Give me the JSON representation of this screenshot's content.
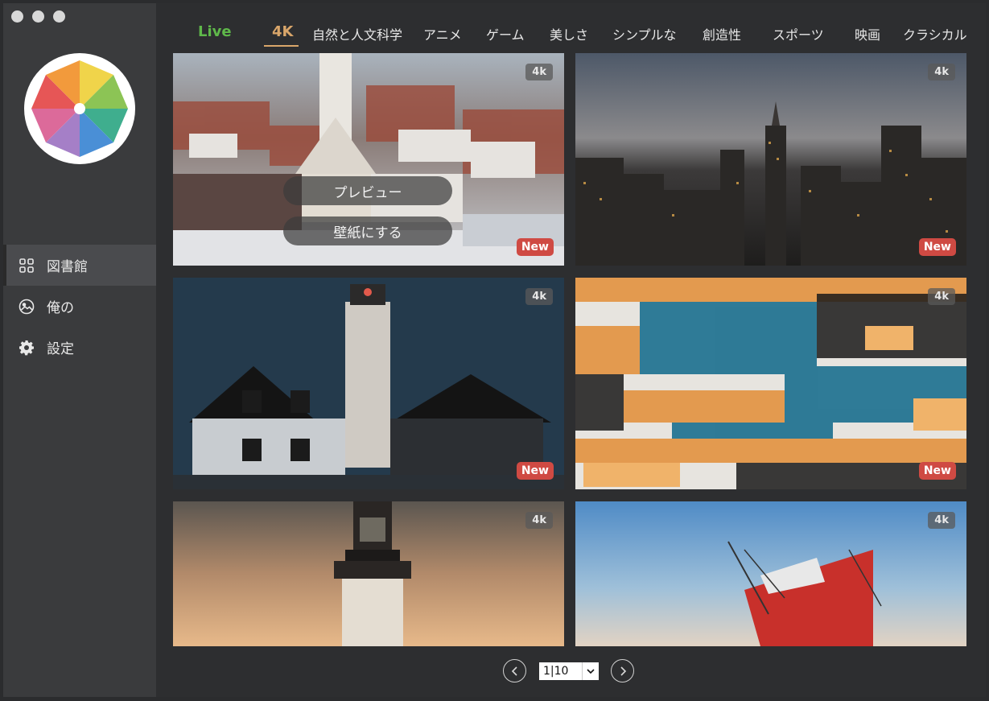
{
  "tabs": [
    "Live",
    "4K",
    "自然と人文科学",
    "アニメ",
    "ゲーム",
    "美しさ",
    "シンプルな",
    "創造性",
    "スポーツ",
    "映画",
    "クラシカル"
  ],
  "sidebar": {
    "items": [
      {
        "label": "図書館",
        "icon": "grid-icon"
      },
      {
        "label": "俺の",
        "icon": "image-icon"
      },
      {
        "label": "設定",
        "icon": "gear-icon"
      }
    ]
  },
  "wallpapers": [
    {
      "badge": "4k",
      "new_label": "New"
    },
    {
      "badge": "4k",
      "new_label": "New"
    },
    {
      "badge": "4k",
      "new_label": "New"
    },
    {
      "badge": "4k",
      "new_label": "New"
    },
    {
      "badge": "4k"
    },
    {
      "badge": "4k"
    }
  ],
  "overlay": {
    "preview_label": "プレビュー",
    "set_wallpaper_label": "壁紙にする"
  },
  "pagination": {
    "value": "1|10"
  },
  "colors": {
    "live": "#5fb84a",
    "active_tab": "#d9a66a",
    "new_badge": "#cf4a43"
  }
}
